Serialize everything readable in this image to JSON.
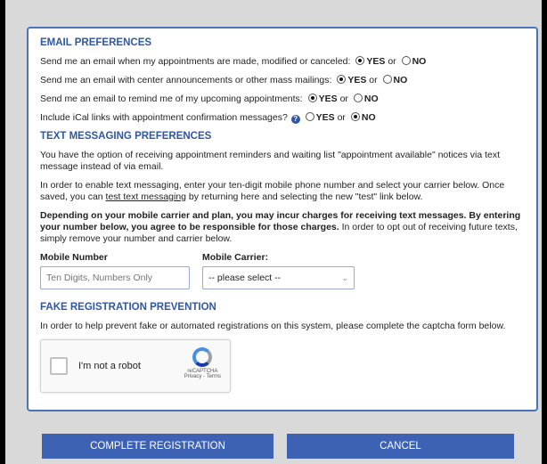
{
  "email": {
    "title": "EMAIL PREFERENCES",
    "prefs": [
      {
        "text": "Send me an email when my appointments are made, modified or canceled:",
        "selected": "yes"
      },
      {
        "text": "Send me an email with center announcements or other mass mailings:",
        "selected": "yes"
      },
      {
        "text": "Send me an email to remind me of my upcoming appointments:",
        "selected": "yes"
      },
      {
        "text": "Include iCal links with appointment confirmation messages?",
        "selected": "no",
        "has_info": true
      }
    ],
    "yes_label": "YES",
    "or_label": "or",
    "no_label": "NO",
    "info_icon": "?"
  },
  "text": {
    "title": "TEXT MESSAGING PREFERENCES",
    "p1": "You have the option of receiving appointment reminders and waiting list \"appointment available\" notices via text message instead of via email.",
    "p2a": "In order to enable text messaging, enter your ten-digit mobile phone number and select your carrier below. Once saved, you can ",
    "p2_link": "test text messaging",
    "p2b": " by returning here and selecting the new \"test\" link below.",
    "p3_bold": "Depending on your mobile carrier and plan, you may incur charges for receiving text messages. By entering your number below, you agree to be responsible for those charges.",
    "p3_rest": " In order to opt out of receiving future texts, simply remove your number and carrier below.",
    "mobile_label": "Mobile Number",
    "mobile_placeholder": "Ten Digits, Numbers Only",
    "carrier_label": "Mobile Carrier:",
    "carrier_value": "-- please select --"
  },
  "fake": {
    "title": "FAKE REGISTRATION PREVENTION",
    "text": "In order to help prevent fake or automated registrations on this system, please complete the captcha form below.",
    "captcha_label": "I'm not a robot",
    "captcha_brand": "reCAPTCHA",
    "captcha_links": "Privacy - Terms"
  },
  "buttons": {
    "complete": "COMPLETE REGISTRATION",
    "cancel": "CANCEL"
  }
}
